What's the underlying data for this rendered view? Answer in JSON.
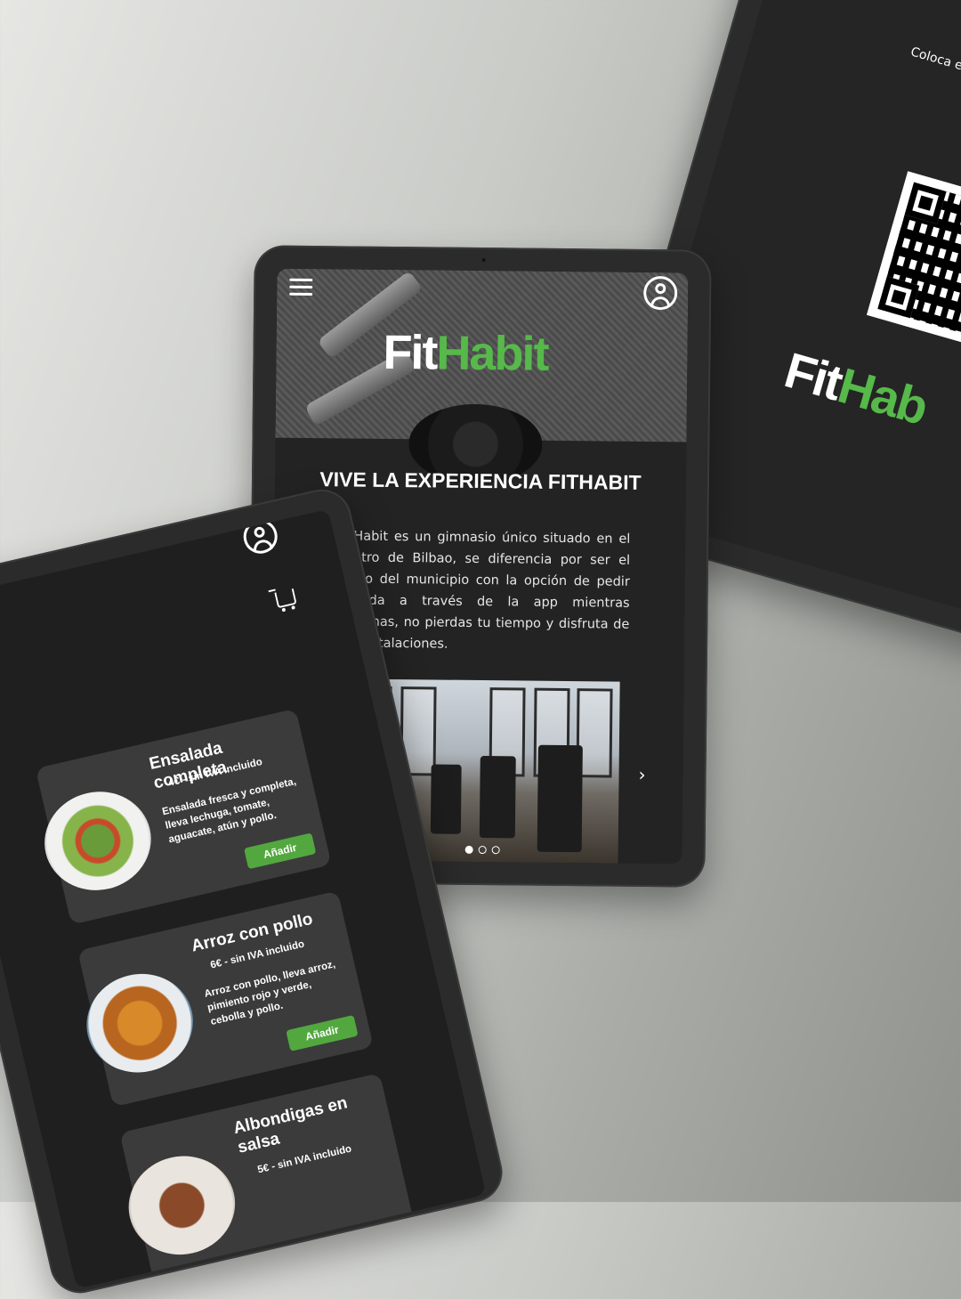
{
  "center": {
    "logo_fit": "Fit",
    "logo_habit": "Habit",
    "headline": "VIVE LA EXPERIENCIA FITHABIT",
    "description": "FitHabit es un gimnasio único situado en el centro de Bilbao, se diferencia por ser el único del municipio con la opción de pedir comida a través de la app mientras entrenas, no pierdas tu tiempo y disfruta de las instalaciones.",
    "carousel": {
      "prev": "‹",
      "next": "›",
      "slides": 3,
      "active": 1
    }
  },
  "menu": {
    "items": [
      {
        "name": "Ensalada completa",
        "price": "4€ - sin IVA incluido",
        "description": "Ensalada fresca y completa, lleva lechuga, tomate, aguacate, atún y pollo.",
        "button": "Añadir"
      },
      {
        "name": "Arroz con pollo",
        "price": "6€ - sin IVA incluido",
        "description": "Arroz con pollo, lleva arroz, pimiento rojo y verde, cebolla y pollo.",
        "button": "Añadir"
      },
      {
        "name": "Albondigas en salsa",
        "price": "5€ - sin IVA incluido",
        "description": "",
        "button": ""
      }
    ]
  },
  "qr_screen": {
    "instruction": "Coloca este QR sobre la torna de la",
    "logo_fit": "Fit",
    "logo_habit": "Hab"
  },
  "colors": {
    "accent_green": "#52a83f",
    "logo_green": "#56b94a",
    "screen_bg": "#232323",
    "card_bg": "#3b3b3b"
  }
}
